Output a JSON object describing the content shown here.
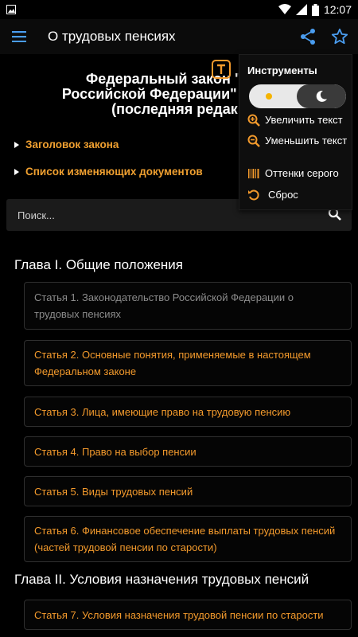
{
  "statusbar": {
    "time": "12:07"
  },
  "toolbar": {
    "title": "О трудовых пенсиях"
  },
  "document": {
    "title_line1": "Федеральный закон \"О тр",
    "title_line2": "Российской Федерации\" от 17.12",
    "title_line3": "(последняя редакц"
  },
  "folds": [
    {
      "label": "Заголовок закона"
    },
    {
      "label": "Список изменяющих документов"
    }
  ],
  "search": {
    "placeholder": "Поиск..."
  },
  "chapters": [
    {
      "title": "Глава I. Общие положения"
    },
    {
      "title": "Глава II. Условия назначения трудовых пенсий"
    }
  ],
  "articles": [
    {
      "label": "Статья 1. Законодательство Российской Федерации о трудовых пенсиях"
    },
    {
      "label": "Статья 2. Основные понятия, применяемые в настоящем Федеральном законе"
    },
    {
      "label": "Статья 3. Лица, имеющие право на трудовую пенсию"
    },
    {
      "label": "Статья 4. Право на выбор пенсии"
    },
    {
      "label": "Статья 5. Виды трудовых пенсий"
    },
    {
      "label": "Статья 6. Финансовое обеспечение выплаты трудовых пенсий (частей трудовой пенсии по старости)"
    },
    {
      "label": "Статья 7. Условия назначения трудовой пенсии по старости"
    }
  ],
  "tools_menu": {
    "title": "Инструменты",
    "theme": "dark",
    "items": [
      {
        "label": "Увеличить текст",
        "icon": "zoom-in-icon"
      },
      {
        "label": "Уменьшить текст",
        "icon": "zoom-out-icon"
      },
      {
        "label": "Оттенки серого",
        "icon": "barcode-icon"
      },
      {
        "label": "Сброс",
        "icon": "reset-icon"
      }
    ]
  },
  "colors": {
    "accent": "#f39a2c",
    "background": "#000000",
    "toolbar_icons": "#4a9df0",
    "inactive_text": "#8c8c8c"
  }
}
